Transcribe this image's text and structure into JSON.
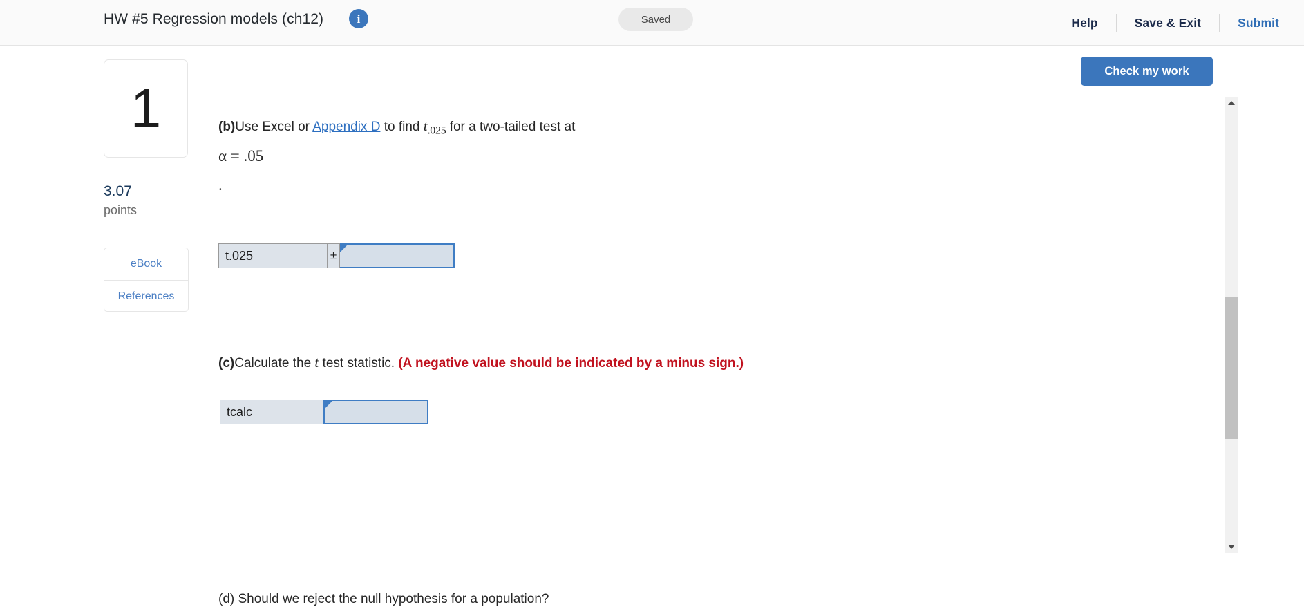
{
  "header": {
    "title": "HW #5 Regression models (ch12)",
    "info_icon": "info-icon",
    "status_badge": "Saved",
    "nav": [
      {
        "label": "Help",
        "style": "dark"
      },
      {
        "label": "Save & Exit",
        "style": "dark"
      },
      {
        "label": "Submit",
        "style": "link"
      }
    ]
  },
  "toolbar": {
    "check_my_work_label": "Check my work",
    "accent_color": "#3b76bc"
  },
  "sidebar": {
    "question_number": "1",
    "points_value": "3.07",
    "points_label": "points",
    "resources": [
      {
        "label": "eBook"
      },
      {
        "label": "References"
      }
    ]
  },
  "question": {
    "part_b": {
      "marker": "(b)",
      "text_1": "Use Excel or ",
      "link": "Appendix D",
      "text_2": " to find ",
      "sym": "t",
      "sub": ".025",
      "text_3": " for a two-tailed test at",
      "formula": "α = .05",
      "formula_end": ".",
      "answer_row": {
        "label": "t.025",
        "operator": "±",
        "input_value": "",
        "input_placeholder": ""
      }
    },
    "part_c": {
      "marker": "(c)",
      "text_1": "Calculate the ",
      "sym": "t",
      "text_2": " test statistic. ",
      "warning": "(A negative value should be indicated by a minus sign.)",
      "answer_row": {
        "label": "tcalc",
        "input_value": "",
        "input_placeholder": ""
      }
    },
    "part_d_cutoff": "(d) Should we reject the null hypothesis for a population?"
  },
  "scrollbar": {
    "up_icon": "chevron-up-icon",
    "down_icon": "chevron-down-icon",
    "thumb": "scrollbar-thumb"
  }
}
